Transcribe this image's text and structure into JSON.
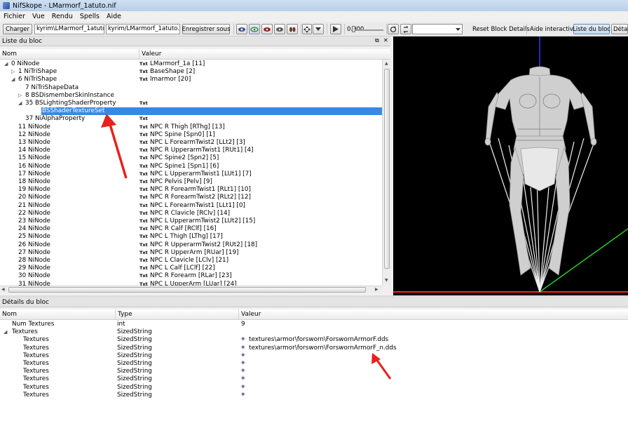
{
  "window": {
    "title": "NifSkope - LMarmorf_1atuto.nif"
  },
  "menu": [
    "Fichier",
    "Vue",
    "Rendu",
    "Spells",
    "Aide"
  ],
  "toolbar": {
    "load_label": "Charger",
    "path_left": "kyrim\\LMarmorf_1atuto.nif",
    "path_right": "kyrim/LMarmorf_1atuto.nif",
    "save_as_label": "Enregistrer sous",
    "time_value": "0.000",
    "reset_block_details_label": "Reset Block Details",
    "interactive_help_label": "Aide interactive",
    "block_list_label": "Liste du bloc",
    "block_details_tab_label": "Déta"
  },
  "block_list": {
    "title": "Liste du bloc",
    "columns": {
      "name": "Nom",
      "value": "Valeur"
    },
    "type_badge": "Txt",
    "rows": [
      {
        "indent": 0,
        "toggle": "collapse",
        "name": "0 NiNode",
        "txt": true,
        "value": "LMarmorf_1a [11]"
      },
      {
        "indent": 1,
        "toggle": "expand",
        "name": "1 NiTriShape",
        "txt": true,
        "value": "BaseShape [2]"
      },
      {
        "indent": 1,
        "toggle": "collapse",
        "name": "6 NiTriShape",
        "txt": true,
        "value": "lmarmor [20]"
      },
      {
        "indent": 2,
        "toggle": "none",
        "name": "7 NiTriShapeData",
        "txt": false,
        "value": ""
      },
      {
        "indent": 2,
        "toggle": "expand",
        "name": "8 BSDismemberSkinInstance",
        "txt": false,
        "value": ""
      },
      {
        "indent": 2,
        "toggle": "collapse",
        "name": "35 BSLightingShaderProperty",
        "txt": true,
        "value": ""
      },
      {
        "indent": 3,
        "toggle": "none",
        "name": "36 BSShaderTextureSet",
        "txt": false,
        "value": "",
        "selected": true
      },
      {
        "indent": 2,
        "toggle": "none",
        "name": "37 NiAlphaProperty",
        "txt": true,
        "value": ""
      },
      {
        "indent": 1,
        "toggle": "none",
        "name": "11 NiNode",
        "txt": true,
        "value": "NPC R Thigh [RThg] [13]"
      },
      {
        "indent": 1,
        "toggle": "none",
        "name": "12 NiNode",
        "txt": true,
        "value": "NPC Spine [Spn0] [1]"
      },
      {
        "indent": 1,
        "toggle": "none",
        "name": "13 NiNode",
        "txt": true,
        "value": "NPC L ForearmTwist2 [LLt2] [3]"
      },
      {
        "indent": 1,
        "toggle": "none",
        "name": "14 NiNode",
        "txt": true,
        "value": "NPC R UpperarmTwist1 [RUt1] [4]"
      },
      {
        "indent": 1,
        "toggle": "none",
        "name": "15 NiNode",
        "txt": true,
        "value": "NPC Spine2 [Spn2] [5]"
      },
      {
        "indent": 1,
        "toggle": "none",
        "name": "16 NiNode",
        "txt": true,
        "value": "NPC Spine1 [Spn1] [6]"
      },
      {
        "indent": 1,
        "toggle": "none",
        "name": "17 NiNode",
        "txt": true,
        "value": "NPC L UpperarmTwist1 [LUt1] [7]"
      },
      {
        "indent": 1,
        "toggle": "none",
        "name": "18 NiNode",
        "txt": true,
        "value": "NPC Pelvis [Pelv] [9]"
      },
      {
        "indent": 1,
        "toggle": "none",
        "name": "19 NiNode",
        "txt": true,
        "value": "NPC R ForearmTwist1 [RLt1] [10]"
      },
      {
        "indent": 1,
        "toggle": "none",
        "name": "20 NiNode",
        "txt": true,
        "value": "NPC R ForearmTwist2 [RLt2] [12]"
      },
      {
        "indent": 1,
        "toggle": "none",
        "name": "21 NiNode",
        "txt": true,
        "value": "NPC L ForearmTwist1 [LLt1] [0]"
      },
      {
        "indent": 1,
        "toggle": "none",
        "name": "22 NiNode",
        "txt": true,
        "value": "NPC R Clavicle [RClv] [14]"
      },
      {
        "indent": 1,
        "toggle": "none",
        "name": "23 NiNode",
        "txt": true,
        "value": "NPC L UpperarmTwist2 [LUt2] [15]"
      },
      {
        "indent": 1,
        "toggle": "none",
        "name": "24 NiNode",
        "txt": true,
        "value": "NPC R Calf [RClf] [16]"
      },
      {
        "indent": 1,
        "toggle": "none",
        "name": "25 NiNode",
        "txt": true,
        "value": "NPC L Thigh [LThg] [17]"
      },
      {
        "indent": 1,
        "toggle": "none",
        "name": "26 NiNode",
        "txt": true,
        "value": "NPC R UpperarmTwist2 [RUt2] [18]"
      },
      {
        "indent": 1,
        "toggle": "none",
        "name": "27 NiNode",
        "txt": true,
        "value": "NPC R UpperArm [RUar] [19]"
      },
      {
        "indent": 1,
        "toggle": "none",
        "name": "28 NiNode",
        "txt": true,
        "value": "NPC L Clavicle [LClv] [21]"
      },
      {
        "indent": 1,
        "toggle": "none",
        "name": "29 NiNode",
        "txt": true,
        "value": "NPC L Calf [LClf] [22]"
      },
      {
        "indent": 1,
        "toggle": "none",
        "name": "30 NiNode",
        "txt": true,
        "value": "NPC R Forearm [RLar] [23]"
      },
      {
        "indent": 1,
        "toggle": "none",
        "name": "31 NiNode",
        "txt": true,
        "value": "NPC L UpperArm [LUar] [24]"
      }
    ]
  },
  "block_details": {
    "title": "Détails du bloc",
    "columns": {
      "name": "Nom",
      "type": "Type",
      "value": "Valeur"
    },
    "rows": [
      {
        "toggle": "none",
        "indent": 1,
        "name": "Num Textures",
        "type": "int",
        "value": "9",
        "icon": false
      },
      {
        "toggle": "collapse",
        "indent": 1,
        "name": "Textures",
        "type": "SizedString",
        "value": "",
        "icon": false
      },
      {
        "toggle": "none",
        "indent": 2,
        "name": "Textures",
        "type": "SizedString",
        "value": "textures\\armor\\forsworn\\ForswornArmorF.dds",
        "icon": true
      },
      {
        "toggle": "none",
        "indent": 2,
        "name": "Textures",
        "type": "SizedString",
        "value": "textures\\armor\\forsworn\\ForswornArmorF_n.dds",
        "icon": true
      },
      {
        "toggle": "none",
        "indent": 2,
        "name": "Textures",
        "type": "SizedString",
        "value": "",
        "icon": true
      },
      {
        "toggle": "none",
        "indent": 2,
        "name": "Textures",
        "type": "SizedString",
        "value": "",
        "icon": true
      },
      {
        "toggle": "none",
        "indent": 2,
        "name": "Textures",
        "type": "SizedString",
        "value": "",
        "icon": true
      },
      {
        "toggle": "none",
        "indent": 2,
        "name": "Textures",
        "type": "SizedString",
        "value": "",
        "icon": true
      },
      {
        "toggle": "none",
        "indent": 2,
        "name": "Textures",
        "type": "SizedString",
        "value": "",
        "icon": true
      },
      {
        "toggle": "none",
        "indent": 2,
        "name": "Textures",
        "type": "SizedString",
        "value": "",
        "icon": true
      }
    ]
  },
  "colors": {
    "selection": "#3b88e0",
    "annotation_arrow": "#e8211c",
    "viewport_bg": "#000000",
    "axis_red": "#ff2020",
    "axis_green": "#22cc22",
    "axis_blue": "#2a3cff",
    "model": "#d2d2d2"
  },
  "icons": {
    "tree_expand": "expand-triangle",
    "tree_collapse": "collapse-triangle",
    "detail_value": "purple-gear"
  }
}
